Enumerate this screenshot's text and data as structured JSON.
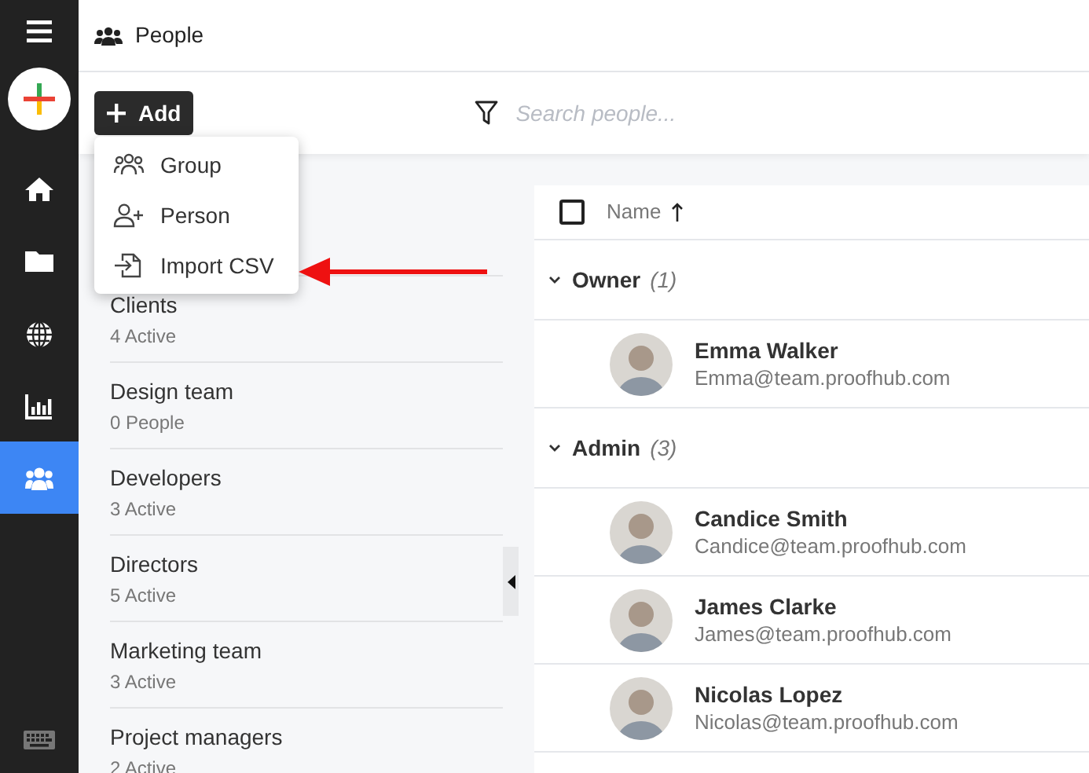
{
  "header": {
    "title": "People"
  },
  "sidebar": {
    "items": [
      {
        "selected": false
      },
      {
        "selected": false
      },
      {
        "selected": false
      },
      {
        "selected": false
      },
      {
        "selected": true
      }
    ]
  },
  "toolbar": {
    "add_button": "Add",
    "search": {
      "placeholder": "Search people..."
    }
  },
  "add_menu": {
    "items": [
      {
        "label": "Group"
      },
      {
        "label": "Person"
      },
      {
        "label": "Import CSV"
      }
    ]
  },
  "groups": [
    {
      "name": "Clients",
      "count": "4 Active"
    },
    {
      "name": "Design team",
      "count": "0 People"
    },
    {
      "name": "Developers",
      "count": "3 Active"
    },
    {
      "name": "Directors",
      "count": "5 Active"
    },
    {
      "name": "Marketing team",
      "count": "3 Active"
    },
    {
      "name": "Project managers",
      "count": "2 Active"
    }
  ],
  "people_list": {
    "select_all": {
      "checked": false
    },
    "sort_column": "Name",
    "sections": [
      {
        "title": "Owner",
        "count": "(1)",
        "expanded": true,
        "people": [
          {
            "name": "Emma Walker",
            "email": "Emma@team.proofhub.com"
          }
        ]
      },
      {
        "title": "Admin",
        "count": "(3)",
        "expanded": true,
        "people": [
          {
            "name": "Candice Smith",
            "email": "Candice@team.proofhub.com"
          },
          {
            "name": "James Clarke",
            "email": "James@team.proofhub.com"
          },
          {
            "name": "Nicolas Lopez",
            "email": "Nicolas@team.proofhub.com"
          }
        ]
      }
    ]
  }
}
